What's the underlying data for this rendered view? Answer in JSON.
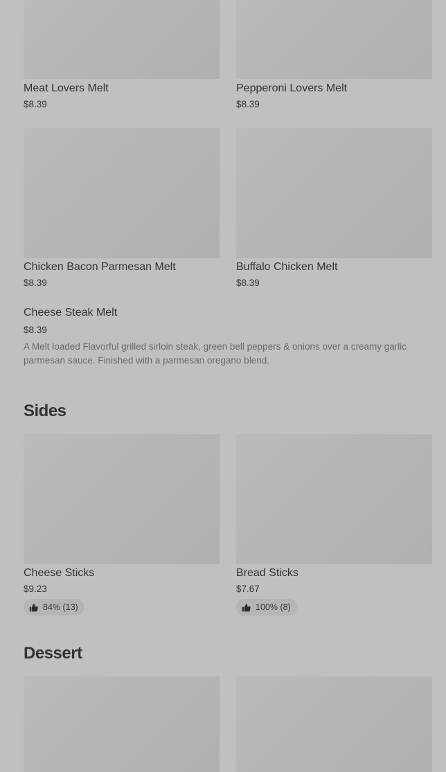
{
  "melts": {
    "items": [
      {
        "name": "Meat Lovers Melt",
        "price": "$8.39"
      },
      {
        "name": "Pepperoni Lovers Melt",
        "price": "$8.39"
      },
      {
        "name": "Chicken Bacon Parmesan Melt",
        "price": "$8.39"
      },
      {
        "name": "Buffalo Chicken Melt",
        "price": "$8.39"
      },
      {
        "name": "Cheese Steak Melt",
        "price": "$8.39",
        "description": "A Melt loaded Flavorful grilled sirloin steak, green bell peppers & onions over a creamy garlic parmesan sauce. Finished with a parmesan oregano blend."
      }
    ]
  },
  "sides": {
    "title": "Sides",
    "items": [
      {
        "name": "Cheese Sticks",
        "price": "$9.23",
        "rating": "84% (13)",
        "icon": "thumbs-up-icon"
      },
      {
        "name": "Bread Sticks",
        "price": "$7.67",
        "rating": "100% (8)",
        "icon": "thumbs-up-icon"
      }
    ]
  },
  "dessert": {
    "title": "Dessert"
  }
}
